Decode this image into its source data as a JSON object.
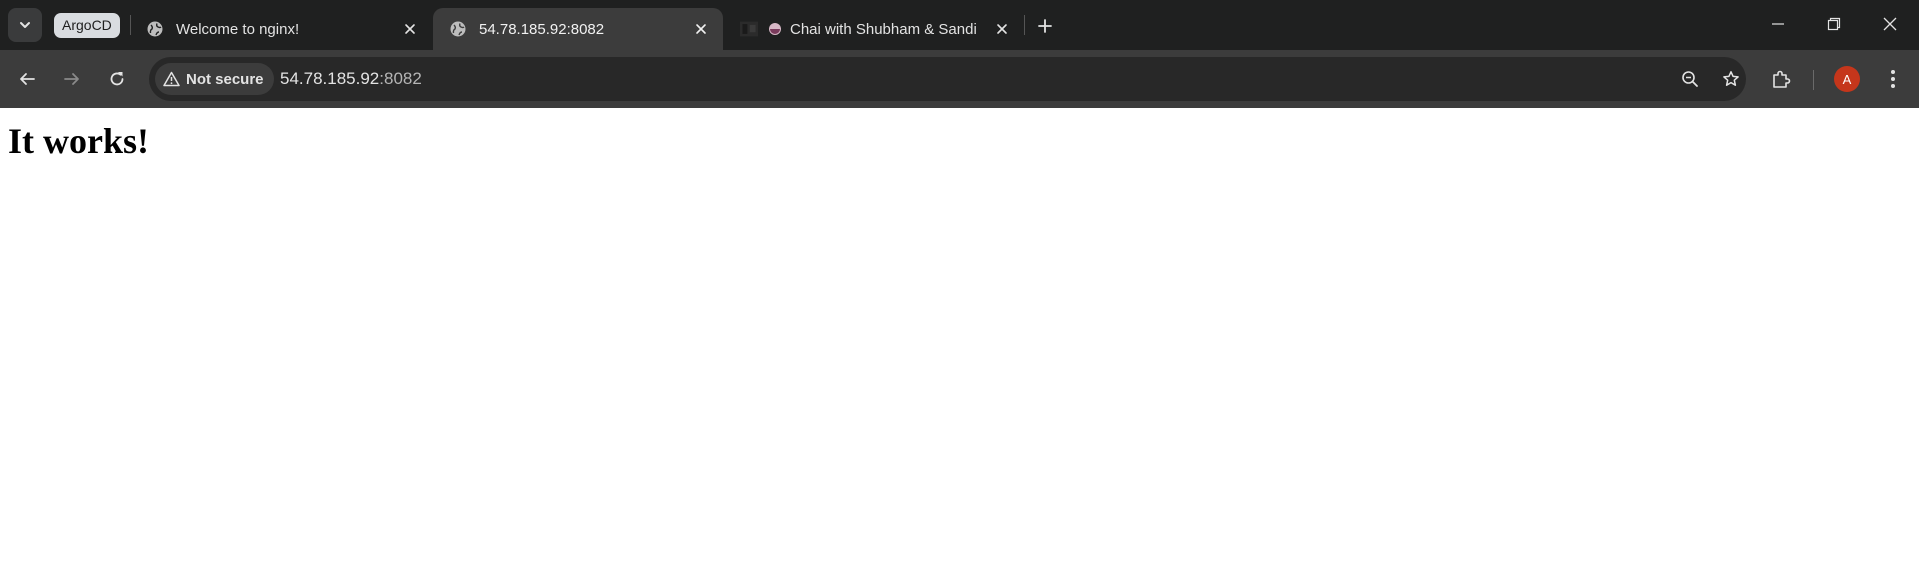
{
  "browser": {
    "tab_group_label": "ArgoCD",
    "tabs": [
      {
        "title": "Welcome to nginx!",
        "favicon": "globe-icon",
        "active": false
      },
      {
        "title": "54.78.185.92:8082",
        "favicon": "globe-icon",
        "active": true
      },
      {
        "title": "Chai with Shubham & Sandi",
        "favicon": "teacup-icon",
        "active": false
      }
    ],
    "security_label": "Not secure",
    "url_host": "54.78.185.92",
    "url_port": ":8082",
    "avatar_initial": "A",
    "avatar_color": "#c5361b"
  },
  "page": {
    "heading": "It works!"
  }
}
